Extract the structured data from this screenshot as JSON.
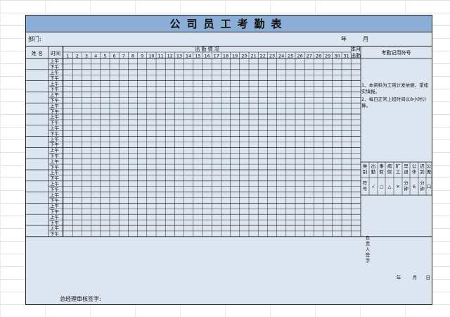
{
  "title": "公司员工考勤表",
  "meta": {
    "dept_label": "部门:",
    "year_label": "年",
    "month_label": "月"
  },
  "header": {
    "name": "姓 名",
    "time": "时间",
    "attendance": "出 勤 情 况",
    "days": [
      "1",
      "2",
      "3",
      "4",
      "5",
      "6",
      "7",
      "8",
      "9",
      "10",
      "11",
      "12",
      "13",
      "14",
      "15",
      "16",
      "17",
      "18",
      "19",
      "20",
      "21",
      "22",
      "23",
      "24",
      "25",
      "26",
      "27",
      "28",
      "29",
      "30",
      "31"
    ],
    "monthly_line1": "本月",
    "monthly_line2": "出勤",
    "symbols_title": "考勤记用符号"
  },
  "periods": {
    "am": "上午",
    "pm": "下午"
  },
  "row_count": 16,
  "notes": [
    "1、本资料为工资计发依据，望如实填报。",
    "2、每日正常上班时间以8小时计算。"
  ],
  "legend": {
    "type_label": "类别",
    "symbol_label": "符号",
    "types": [
      "出勤",
      "事假",
      "病假",
      "旷工",
      "早退",
      "公休",
      "迟到",
      "公差"
    ],
    "symbols": [
      "√",
      "○",
      "△",
      "✕",
      "分钟",
      "6",
      "分钟",
      "口"
    ],
    "symbol_colors": [
      "#1a7a30",
      "#c0202a",
      "#c0202a",
      "#c0202a",
      "#111111",
      "#111111",
      "#111111",
      "#111111"
    ]
  },
  "sign": {
    "label": "负责人签字",
    "year": "年",
    "month": "月",
    "day": "日"
  },
  "footer": {
    "gm_sign": "总经理审核签字:"
  }
}
